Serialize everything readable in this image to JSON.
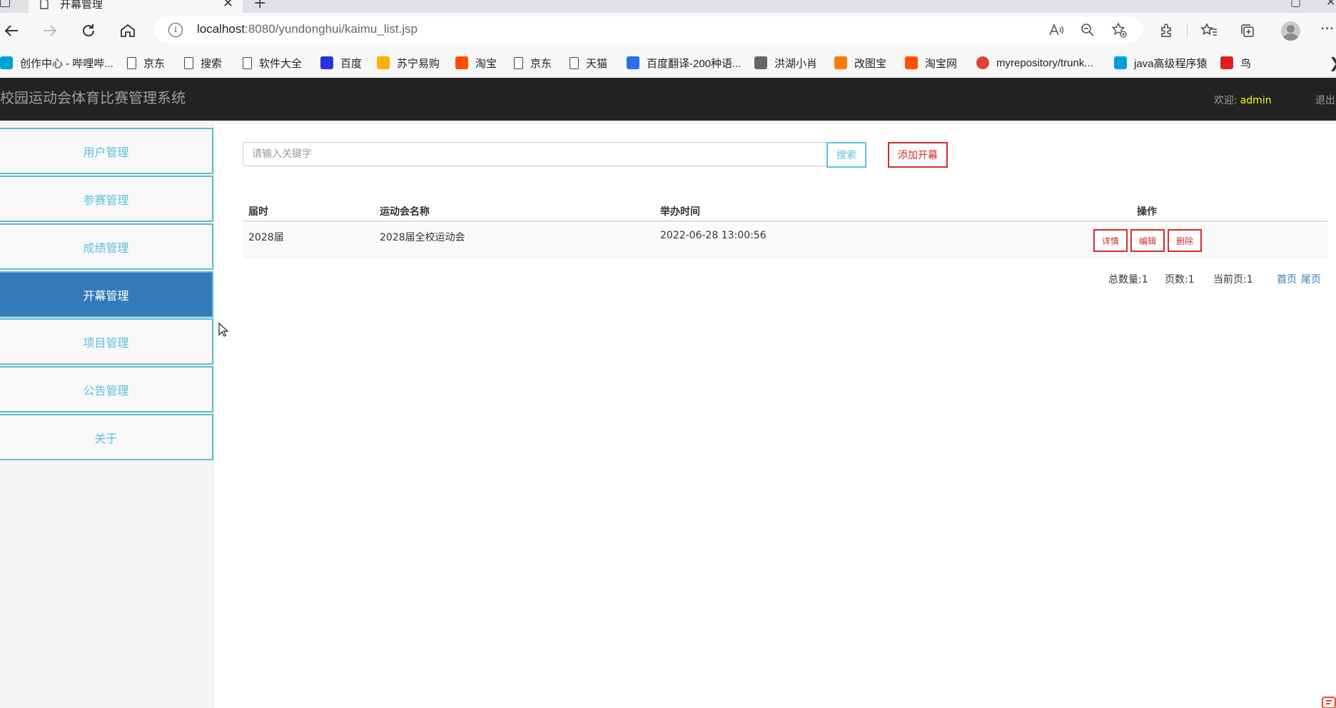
{
  "browser": {
    "tab_title": "开幕管理",
    "new_tab_label": "+",
    "close_label": "✕",
    "url_host": "localhost",
    "url_rest": ":8080/yundonghui/kaimu_list.jsp",
    "info_label": "i",
    "menu_label": "···",
    "more_bookmarks_label": "❯"
  },
  "bookmarks": [
    {
      "label": "创作中心 - 哔哩哔...",
      "icon": "bilibili-icon",
      "color": "#00a1d6"
    },
    {
      "label": "京东",
      "icon": "page-icon"
    },
    {
      "label": "搜索",
      "icon": "page-icon"
    },
    {
      "label": "软件大全",
      "icon": "page-icon"
    },
    {
      "label": "百度",
      "icon": "baidu-icon",
      "color": "#2932e1"
    },
    {
      "label": "苏宁易购",
      "icon": "suning-icon",
      "color": "#f6b400"
    },
    {
      "label": "淘宝",
      "icon": "taobao-icon",
      "color": "#ff5000"
    },
    {
      "label": "京东",
      "icon": "page-icon"
    },
    {
      "label": "天猫",
      "icon": "page-icon"
    },
    {
      "label": "百度翻译-200种语...",
      "icon": "translate-icon",
      "color": "#2a6ee8"
    },
    {
      "label": "洪湖小肖",
      "icon": "bird-icon",
      "color": "#666666"
    },
    {
      "label": "改图宝",
      "icon": "gaitubao-icon",
      "color": "#ff7a00"
    },
    {
      "label": "淘宝网",
      "icon": "taobao-icon",
      "color": "#ff5000"
    },
    {
      "label": "myrepository/trunk...",
      "icon": "chrome-icon",
      "color": "#db4437"
    },
    {
      "label": "java高级程序猿",
      "icon": "bilibili-icon",
      "color": "#00a1d6"
    },
    {
      "label": "鸟",
      "icon": "bird-red-icon",
      "color": "#e02020"
    }
  ],
  "app": {
    "brand": "校园运动会体育比赛管理系统",
    "welcome_label": "欢迎:",
    "username": "admin",
    "logout_label": "退出"
  },
  "sidebar": {
    "items": [
      {
        "label": "用户管理",
        "active": false
      },
      {
        "label": "参赛管理",
        "active": false
      },
      {
        "label": "成绩管理",
        "active": false
      },
      {
        "label": "开幕管理",
        "active": true
      },
      {
        "label": "项目管理",
        "active": false
      },
      {
        "label": "公告管理",
        "active": false
      },
      {
        "label": "关于",
        "active": false
      }
    ]
  },
  "toolbar": {
    "search_placeholder": "请输入关键字",
    "search_label": "搜索",
    "add_label": "添加开幕"
  },
  "table": {
    "headers": [
      "届时",
      "运动会名称",
      "举办时间",
      "操作"
    ],
    "rows": [
      {
        "session": "2028届",
        "name": "2028届全校运动会",
        "time": "2022-06-28 13:00:56",
        "actions": [
          "详情",
          "编辑",
          "删除"
        ]
      }
    ]
  },
  "pager": {
    "total_label": "总数量:1",
    "pages_label": "页数:1",
    "current_label": "当前页:1",
    "first_label": "首页",
    "last_label": "尾页"
  },
  "colors": {
    "header_bg": "#222222",
    "active_nav_bg": "#337ab7",
    "nav_text": "#5bc0de",
    "danger": "#c9302c",
    "username": "#ffff00"
  }
}
